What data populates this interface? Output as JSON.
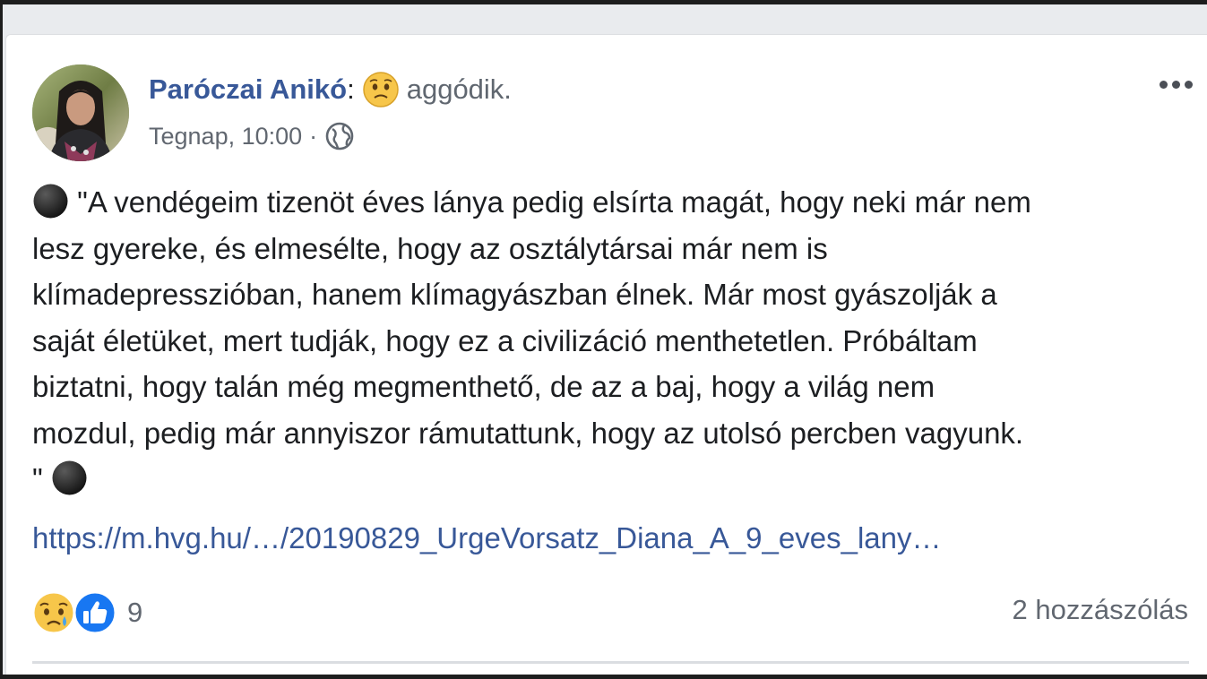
{
  "post": {
    "author": "Paróczai Anikó",
    "colon": ":",
    "feeling": "aggódik.",
    "timestamp": "Tegnap, 10:00",
    "separator": "·",
    "text_para1_segments": [
      "\"A vendégeim tizenöt éves lánya pedig elsírta magát, hogy neki már nem",
      "lesz gyereke, és elmesélte, hogy az osztálytársai már nem is",
      "klímadepresszióban, hanem klímagyászban élnek. Már most gyászolják a",
      "saját életüket, mert tudják, hogy ez a civilizáció menthetetlen. Próbáltam",
      "biztatni, hogy talán még megmenthető, de az a baj, hogy a világ nem",
      "mozdul, pedig már annyiszor rámutattunk, hogy az utolsó percben vagyunk."
    ],
    "text_tail": "\"",
    "link": "https://m.hvg.hu/…/20190829_UrgeVorsatz_Diana_A_9_eves_lany…",
    "reaction_count": "9",
    "comment_count": "2 hozzászólás"
  },
  "icons": {
    "feeling": "worried-face-icon",
    "privacy": "globe-icon",
    "bullet": "black-circle-icon",
    "reaction_1": "sad-reaction-icon",
    "reaction_2": "like-reaction-icon",
    "more": "more-options-icon"
  },
  "colors": {
    "author": "#385898",
    "secondary_text": "#616770",
    "body_text": "#1c1e21",
    "like_blue": "#1877f2",
    "background": "#e9ebee"
  }
}
